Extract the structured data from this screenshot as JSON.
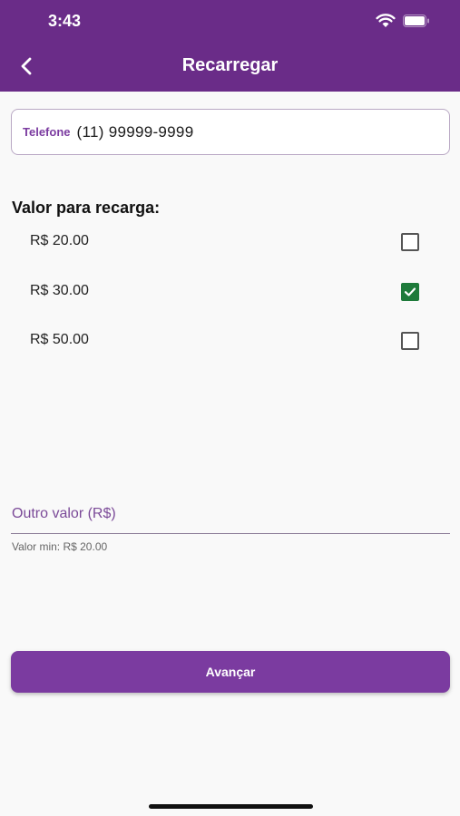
{
  "status_bar": {
    "time": "3:43"
  },
  "header": {
    "title": "Recarregar",
    "back_icon": "chevron-left-icon"
  },
  "phone": {
    "label": "Telefone",
    "value": "(11) 99999-9999"
  },
  "section_title": "Valor para recarga:",
  "options": [
    {
      "label": "R$ 20.00",
      "checked": false
    },
    {
      "label": "R$ 30.00",
      "checked": true
    },
    {
      "label": "R$ 50.00",
      "checked": false
    }
  ],
  "other_value": {
    "placeholder": "Outro valor (R$)",
    "value": "",
    "helper": "Valor min: R$ 20.00"
  },
  "next_button": {
    "label": "Avançar"
  },
  "colors": {
    "header": "#6a2c88",
    "accent": "#7b3ba0",
    "checkbox_checked": "#1e7a3a",
    "background": "#f9f9f9"
  }
}
